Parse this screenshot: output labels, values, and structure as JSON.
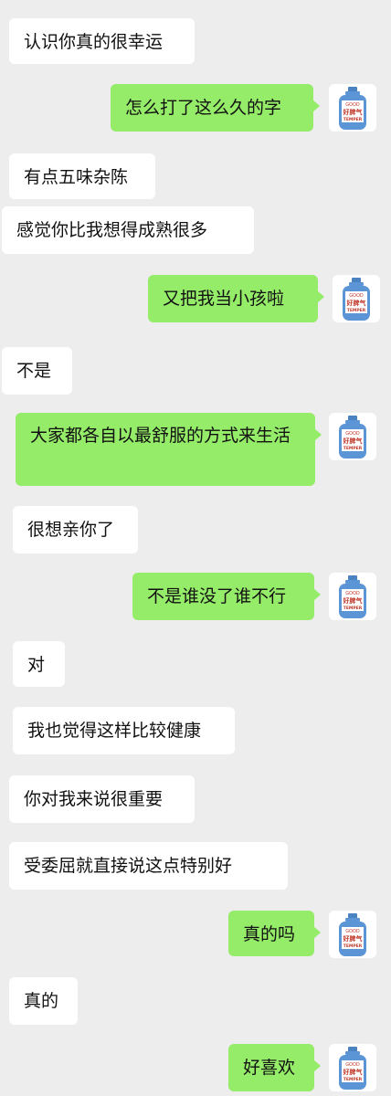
{
  "chat": {
    "messages": [
      {
        "side": "in",
        "text": "认识你真的很幸运"
      },
      {
        "side": "out",
        "text": "怎么打了这么久的字"
      },
      {
        "side": "in",
        "text": "有点五味杂陈"
      },
      {
        "side": "in",
        "text": "感觉你比我想得成熟很多"
      },
      {
        "side": "out",
        "text": "又把我当小孩啦"
      },
      {
        "side": "in",
        "text": "不是"
      },
      {
        "side": "out",
        "text": "大家都各自以最舒服的方式来生活"
      },
      {
        "side": "in",
        "text": "很想亲你了"
      },
      {
        "side": "out",
        "text": "不是谁没了谁不行"
      },
      {
        "side": "in",
        "text": "对"
      },
      {
        "side": "in",
        "text": "我也觉得这样比较健康"
      },
      {
        "side": "in",
        "text": "你对我来说很重要"
      },
      {
        "side": "in",
        "text": "受委屈就直接说这点特别好"
      },
      {
        "side": "out",
        "text": "真的吗"
      },
      {
        "side": "in",
        "text": "真的"
      },
      {
        "side": "out",
        "text": "好喜欢"
      }
    ],
    "avatar": {
      "icon": "gas-cylinder-icon",
      "label_top": "GOOD",
      "label_mid": "好脾气",
      "label_bottom": "TEMPER"
    },
    "colors": {
      "background": "#ededed",
      "incoming_bubble": "#ffffff",
      "outgoing_bubble": "#95ec69",
      "text": "#111111",
      "cylinder": "#5b95d6"
    }
  }
}
